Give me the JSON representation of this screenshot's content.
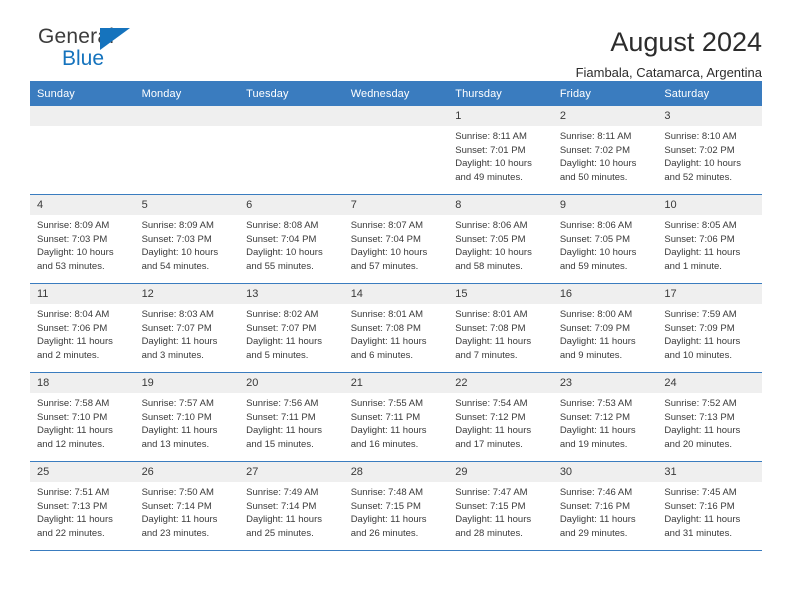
{
  "brand": {
    "name_top": "General",
    "name_bottom": "Blue",
    "accent_color": "#1573bd"
  },
  "header": {
    "title": "August 2024",
    "subtitle": "Fiambala, Catamarca, Argentina"
  },
  "theme": {
    "header_row_color": "#3a7cbf",
    "daynum_band_color": "#efefef",
    "grid_line_color": "#3a7cbf"
  },
  "weekday_headers": [
    "Sunday",
    "Monday",
    "Tuesday",
    "Wednesday",
    "Thursday",
    "Friday",
    "Saturday"
  ],
  "weeks": [
    [
      {
        "day": "",
        "sunrise": "",
        "sunset": "",
        "daylight": "",
        "empty": true
      },
      {
        "day": "",
        "sunrise": "",
        "sunset": "",
        "daylight": "",
        "empty": true
      },
      {
        "day": "",
        "sunrise": "",
        "sunset": "",
        "daylight": "",
        "empty": true
      },
      {
        "day": "",
        "sunrise": "",
        "sunset": "",
        "daylight": "",
        "empty": true
      },
      {
        "day": "1",
        "sunrise": "Sunrise: 8:11 AM",
        "sunset": "Sunset: 7:01 PM",
        "daylight": "Daylight: 10 hours and 49 minutes.",
        "empty": false
      },
      {
        "day": "2",
        "sunrise": "Sunrise: 8:11 AM",
        "sunset": "Sunset: 7:02 PM",
        "daylight": "Daylight: 10 hours and 50 minutes.",
        "empty": false
      },
      {
        "day": "3",
        "sunrise": "Sunrise: 8:10 AM",
        "sunset": "Sunset: 7:02 PM",
        "daylight": "Daylight: 10 hours and 52 minutes.",
        "empty": false
      }
    ],
    [
      {
        "day": "4",
        "sunrise": "Sunrise: 8:09 AM",
        "sunset": "Sunset: 7:03 PM",
        "daylight": "Daylight: 10 hours and 53 minutes.",
        "empty": false
      },
      {
        "day": "5",
        "sunrise": "Sunrise: 8:09 AM",
        "sunset": "Sunset: 7:03 PM",
        "daylight": "Daylight: 10 hours and 54 minutes.",
        "empty": false
      },
      {
        "day": "6",
        "sunrise": "Sunrise: 8:08 AM",
        "sunset": "Sunset: 7:04 PM",
        "daylight": "Daylight: 10 hours and 55 minutes.",
        "empty": false
      },
      {
        "day": "7",
        "sunrise": "Sunrise: 8:07 AM",
        "sunset": "Sunset: 7:04 PM",
        "daylight": "Daylight: 10 hours and 57 minutes.",
        "empty": false
      },
      {
        "day": "8",
        "sunrise": "Sunrise: 8:06 AM",
        "sunset": "Sunset: 7:05 PM",
        "daylight": "Daylight: 10 hours and 58 minutes.",
        "empty": false
      },
      {
        "day": "9",
        "sunrise": "Sunrise: 8:06 AM",
        "sunset": "Sunset: 7:05 PM",
        "daylight": "Daylight: 10 hours and 59 minutes.",
        "empty": false
      },
      {
        "day": "10",
        "sunrise": "Sunrise: 8:05 AM",
        "sunset": "Sunset: 7:06 PM",
        "daylight": "Daylight: 11 hours and 1 minute.",
        "empty": false
      }
    ],
    [
      {
        "day": "11",
        "sunrise": "Sunrise: 8:04 AM",
        "sunset": "Sunset: 7:06 PM",
        "daylight": "Daylight: 11 hours and 2 minutes.",
        "empty": false
      },
      {
        "day": "12",
        "sunrise": "Sunrise: 8:03 AM",
        "sunset": "Sunset: 7:07 PM",
        "daylight": "Daylight: 11 hours and 3 minutes.",
        "empty": false
      },
      {
        "day": "13",
        "sunrise": "Sunrise: 8:02 AM",
        "sunset": "Sunset: 7:07 PM",
        "daylight": "Daylight: 11 hours and 5 minutes.",
        "empty": false
      },
      {
        "day": "14",
        "sunrise": "Sunrise: 8:01 AM",
        "sunset": "Sunset: 7:08 PM",
        "daylight": "Daylight: 11 hours and 6 minutes.",
        "empty": false
      },
      {
        "day": "15",
        "sunrise": "Sunrise: 8:01 AM",
        "sunset": "Sunset: 7:08 PM",
        "daylight": "Daylight: 11 hours and 7 minutes.",
        "empty": false
      },
      {
        "day": "16",
        "sunrise": "Sunrise: 8:00 AM",
        "sunset": "Sunset: 7:09 PM",
        "daylight": "Daylight: 11 hours and 9 minutes.",
        "empty": false
      },
      {
        "day": "17",
        "sunrise": "Sunrise: 7:59 AM",
        "sunset": "Sunset: 7:09 PM",
        "daylight": "Daylight: 11 hours and 10 minutes.",
        "empty": false
      }
    ],
    [
      {
        "day": "18",
        "sunrise": "Sunrise: 7:58 AM",
        "sunset": "Sunset: 7:10 PM",
        "daylight": "Daylight: 11 hours and 12 minutes.",
        "empty": false
      },
      {
        "day": "19",
        "sunrise": "Sunrise: 7:57 AM",
        "sunset": "Sunset: 7:10 PM",
        "daylight": "Daylight: 11 hours and 13 minutes.",
        "empty": false
      },
      {
        "day": "20",
        "sunrise": "Sunrise: 7:56 AM",
        "sunset": "Sunset: 7:11 PM",
        "daylight": "Daylight: 11 hours and 15 minutes.",
        "empty": false
      },
      {
        "day": "21",
        "sunrise": "Sunrise: 7:55 AM",
        "sunset": "Sunset: 7:11 PM",
        "daylight": "Daylight: 11 hours and 16 minutes.",
        "empty": false
      },
      {
        "day": "22",
        "sunrise": "Sunrise: 7:54 AM",
        "sunset": "Sunset: 7:12 PM",
        "daylight": "Daylight: 11 hours and 17 minutes.",
        "empty": false
      },
      {
        "day": "23",
        "sunrise": "Sunrise: 7:53 AM",
        "sunset": "Sunset: 7:12 PM",
        "daylight": "Daylight: 11 hours and 19 minutes.",
        "empty": false
      },
      {
        "day": "24",
        "sunrise": "Sunrise: 7:52 AM",
        "sunset": "Sunset: 7:13 PM",
        "daylight": "Daylight: 11 hours and 20 minutes.",
        "empty": false
      }
    ],
    [
      {
        "day": "25",
        "sunrise": "Sunrise: 7:51 AM",
        "sunset": "Sunset: 7:13 PM",
        "daylight": "Daylight: 11 hours and 22 minutes.",
        "empty": false
      },
      {
        "day": "26",
        "sunrise": "Sunrise: 7:50 AM",
        "sunset": "Sunset: 7:14 PM",
        "daylight": "Daylight: 11 hours and 23 minutes.",
        "empty": false
      },
      {
        "day": "27",
        "sunrise": "Sunrise: 7:49 AM",
        "sunset": "Sunset: 7:14 PM",
        "daylight": "Daylight: 11 hours and 25 minutes.",
        "empty": false
      },
      {
        "day": "28",
        "sunrise": "Sunrise: 7:48 AM",
        "sunset": "Sunset: 7:15 PM",
        "daylight": "Daylight: 11 hours and 26 minutes.",
        "empty": false
      },
      {
        "day": "29",
        "sunrise": "Sunrise: 7:47 AM",
        "sunset": "Sunset: 7:15 PM",
        "daylight": "Daylight: 11 hours and 28 minutes.",
        "empty": false
      },
      {
        "day": "30",
        "sunrise": "Sunrise: 7:46 AM",
        "sunset": "Sunset: 7:16 PM",
        "daylight": "Daylight: 11 hours and 29 minutes.",
        "empty": false
      },
      {
        "day": "31",
        "sunrise": "Sunrise: 7:45 AM",
        "sunset": "Sunset: 7:16 PM",
        "daylight": "Daylight: 11 hours and 31 minutes.",
        "empty": false
      }
    ]
  ]
}
